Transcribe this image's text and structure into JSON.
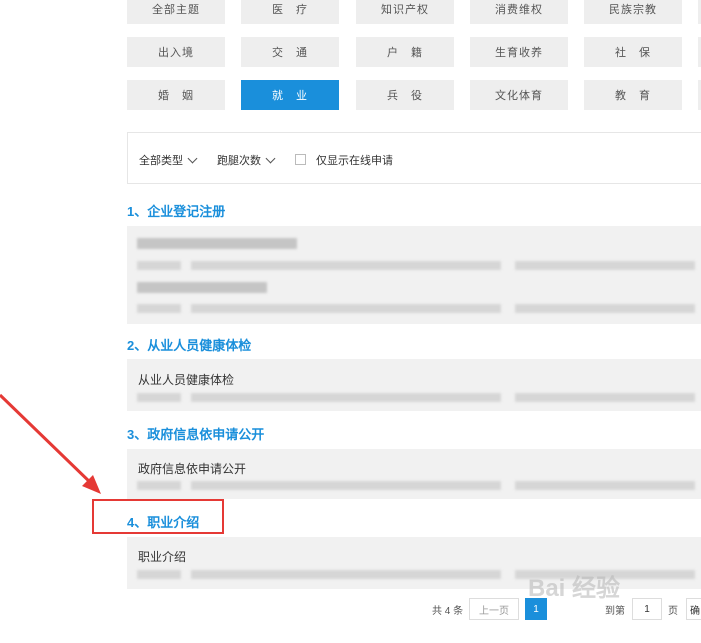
{
  "categories": {
    "row1": [
      "全部主题",
      "医　疗",
      "知识产权",
      "消费维权",
      "民族宗教"
    ],
    "row2": [
      "出入境",
      "交　通",
      "户　籍",
      "生育收养",
      "社　保"
    ],
    "row3": [
      "婚　姻",
      "就　业",
      "兵　役",
      "文化体育",
      "教　育"
    ],
    "active": "就　业"
  },
  "filters": {
    "type_label": "全部类型",
    "visits_label": "跑腿次数",
    "online_only_label": "仅显示在线申请"
  },
  "sections": [
    {
      "title": "1、企业登记注册",
      "item": ""
    },
    {
      "title": "2、从业人员健康体检",
      "item": "从业人员健康体检"
    },
    {
      "title": "3、政府信息依申请公开",
      "item": "政府信息依申请公开"
    },
    {
      "title": "4、职业介绍",
      "item": "职业介绍"
    }
  ],
  "pagination": {
    "total": "共 4 条",
    "prev": "上一页",
    "current": "1",
    "goto": "到第",
    "page_input": "1",
    "page_unit": "页",
    "confirm": "确"
  },
  "watermark": "Bai 经验",
  "colors": {
    "accent": "#1a8fdb",
    "annotation": "#e53935"
  }
}
